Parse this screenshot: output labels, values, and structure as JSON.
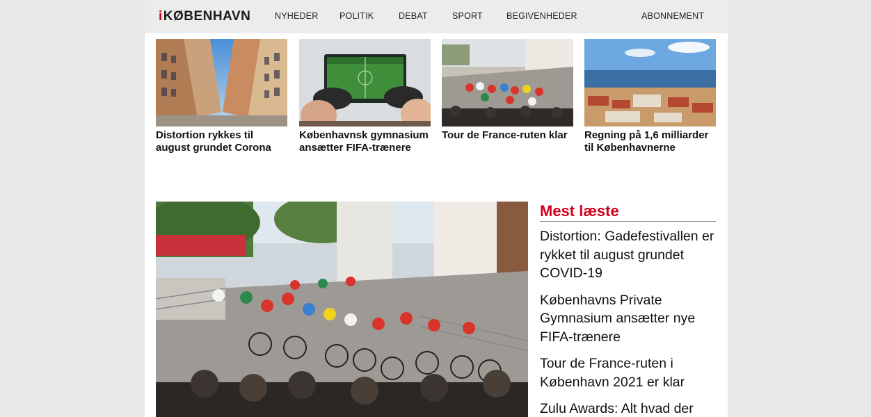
{
  "header": {
    "logo_i": "i",
    "logo_text": "KØBENHAVN",
    "nav": [
      "NYHEDER",
      "POLITIK",
      "DEBAT",
      "SPORT",
      "BEGIVENHEDER"
    ],
    "subscribe": "ABONNEMENT",
    "accent": "#d0021b"
  },
  "cards": [
    {
      "title": "Distortion rykkes til august grundet Corona",
      "image": "copenhagen-street-photo"
    },
    {
      "title": "Københavnsk gymnasium ansætter FIFA-trænere",
      "image": "gaming-controllers-photo"
    },
    {
      "title": "Tour de France-ruten klar",
      "image": "cycling-race-photo"
    },
    {
      "title": "Regning på 1,6 milliarder til Københavnerne",
      "image": "city-harbour-aerial-photo"
    }
  ],
  "hero": {
    "image": "cycling-race-hero-photo"
  },
  "sidebar": {
    "heading": "Mest læste",
    "items": [
      "Distortion: Gadefestivallen er rykket til august grundet COVID-19",
      "Københavns Private Gymnasium ansætter nye FIFA-trænere",
      "Tour de France-ruten i København 2021 er klar",
      "Zulu Awards: Alt hvad der"
    ]
  }
}
